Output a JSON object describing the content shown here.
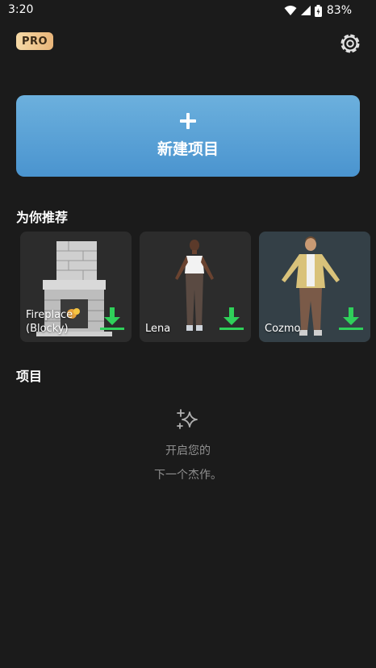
{
  "status": {
    "time": "3:20",
    "battery": "83%"
  },
  "header": {
    "pro_badge": "PRO"
  },
  "new_project": {
    "label": "新建项目"
  },
  "recommended": {
    "title": "为你推荐",
    "items": [
      {
        "label": "Fireplace\n(Blocky)",
        "icon": "download-icon"
      },
      {
        "label": "Lena",
        "icon": "download-icon"
      },
      {
        "label": "Cozmo",
        "icon": "download-icon"
      }
    ]
  },
  "projects": {
    "title": "项目",
    "empty_line1": "开启您的",
    "empty_line2": "下一个杰作。"
  },
  "colors": {
    "accent_blue": "#5aa3d8",
    "download_green": "#2fd05a",
    "pro_gold": "#f0c88e"
  }
}
